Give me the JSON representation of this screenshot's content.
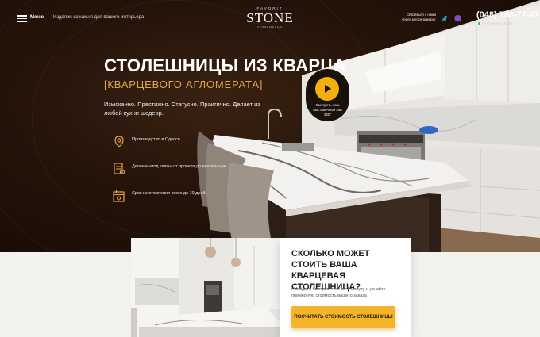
{
  "header": {
    "menu_label": "Меню",
    "tagline": "Изделия из камня для вашего интерьера",
    "logo": {
      "top": "FAVORIT",
      "main": "STONE",
      "sub": "СТОЛЕШНИЦЫ"
    },
    "contact_text": "Связаться с нами через мессенджеры:",
    "phone": "(048) 788-77-47",
    "hours": "Пн-Пт 9:00–18:30",
    "messengers": [
      {
        "icon": "telegram-icon",
        "color": "#2aa3e0"
      },
      {
        "icon": "viber-icon",
        "color": "#7d4fb8"
      }
    ]
  },
  "hero": {
    "title": "СТОЛЕШНИЦЫ ИЗ КВАРЦА",
    "subtitle": "[КВАРЦЕВОГО АГЛОМЕРАТА]",
    "lead": "Изысканно. Престижно. Статусно. Практично. Делает из любой кухни шедевр.",
    "features": [
      {
        "icon": "location-pin-icon",
        "text": "Производство в Одессе"
      },
      {
        "icon": "key-document-icon",
        "text": "Делаем «под ключ» от проекта до реализации"
      },
      {
        "icon": "calendar-icon",
        "text": "Срок изготовления всего до 10 дней"
      }
    ],
    "tour_text": "Смотреть наш выставочный зал 360°"
  },
  "calc": {
    "title": "СКОЛЬКО МОЖЕТ СТОИТЬ ВАША КВАРЦЕВАЯ СТОЛЕШНИЦА?",
    "text": "Пройдите быстрый тест за 1 минуту и узнайте примерную стоимость вашего заказа",
    "button": "ПОСЧИТАТЬ СТОИМОСТЬ СТОЛЕШНИЦЫ"
  },
  "colors": {
    "accent": "#f4b42a",
    "subtitle": "#e0a64a",
    "hero_bg": "#241309"
  }
}
